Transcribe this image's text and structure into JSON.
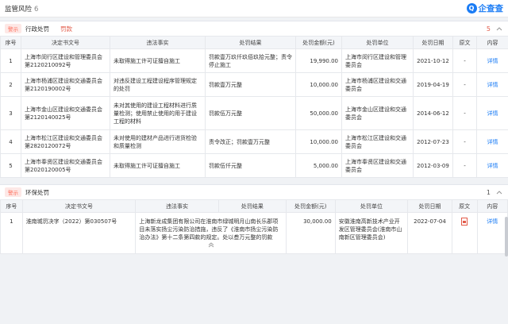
{
  "header": {
    "title": "监管风险",
    "count": "6",
    "logo_mark": "Q",
    "logo_text": "企查查"
  },
  "admin_penalty": {
    "tag": "警示",
    "name": "行政处罚",
    "keyword": "罚款",
    "count": "5",
    "columns": [
      "序号",
      "决定书文号",
      "违法事实",
      "处罚结果",
      "处罚金额(元)",
      "处罚单位",
      "处罚日期",
      "原文",
      "内容"
    ],
    "rows": [
      {
        "no": "1",
        "doc": "上海市闵行区建设和管理委员会第2120210092号",
        "fact": "未取得施工许可证擅自施工",
        "result": "罚款壹万玖仟玖佰玖拾元整；责令停止施工",
        "amount": "19,990.00",
        "unit": "上海市闵行区建设和管理委员会",
        "date": "2021-10-12",
        "orig": "-",
        "detail": "详情"
      },
      {
        "no": "2",
        "doc": "上海市杨浦区建设和交通委员会第2120190002号",
        "fact": "对违反建设工程建设程序管理规定的处罚",
        "result": "罚款壹万元整",
        "amount": "10,000.00",
        "unit": "上海市杨浦区建设和交通委员会",
        "date": "2019-04-19",
        "orig": "-",
        "detail": "详情"
      },
      {
        "no": "3",
        "doc": "上海市金山区建设和交通委员会第2120140025号",
        "fact": "未对其使用的建设工程材料进行质量检测；使用禁止使用的用于建设工程的材料",
        "result": "罚款伍万元整",
        "amount": "50,000.00",
        "unit": "上海市金山区建设和交通委员会",
        "date": "2014-06-12",
        "orig": "-",
        "detail": "详情"
      },
      {
        "no": "4",
        "doc": "上海市松江区建设和交通委员会第2820120072号",
        "fact": "未对使用的建材产品进行进货检验和质量检测",
        "result": "责令改正；罚款壹万元整",
        "amount": "10,000.00",
        "unit": "上海市松江区建设和交通委员会",
        "date": "2012-07-23",
        "orig": "-",
        "detail": "详情"
      },
      {
        "no": "5",
        "doc": "上海市奉贤区建设和交通委员会第2020120005号",
        "fact": "未取得施工许可证擅自施工",
        "result": "罚款伍仟元整",
        "amount": "5,000.00",
        "unit": "上海市奉贤区建设和交通委员会",
        "date": "2012-03-09",
        "orig": "-",
        "detail": "详情"
      }
    ]
  },
  "env_penalty": {
    "tag": "警示",
    "name": "环保处罚",
    "count": "1",
    "columns": [
      "序号",
      "决定书文号",
      "违法事实",
      "处罚结果",
      "处罚金额(元)",
      "处罚单位",
      "处罚日期",
      "原文",
      "内容"
    ],
    "rows": [
      {
        "no": "1",
        "doc": "淮南城罚决字（2022）第030507号",
        "fact": "上海新龙成集团有限公司在淮南市绿城明月山南长乐郡项目未落实扬尘污染防治措施，违反了《淮南市扬尘污染防治办法》第十二条第四款的规定。处以叁万元整的罚款",
        "result": "",
        "amount": "30,000.00",
        "unit": "安徽淮南高新技术产业开发区管理委员会(淮南市山南新区管理委员会)",
        "date": "2022-07-04",
        "detail": "详情"
      }
    ]
  }
}
